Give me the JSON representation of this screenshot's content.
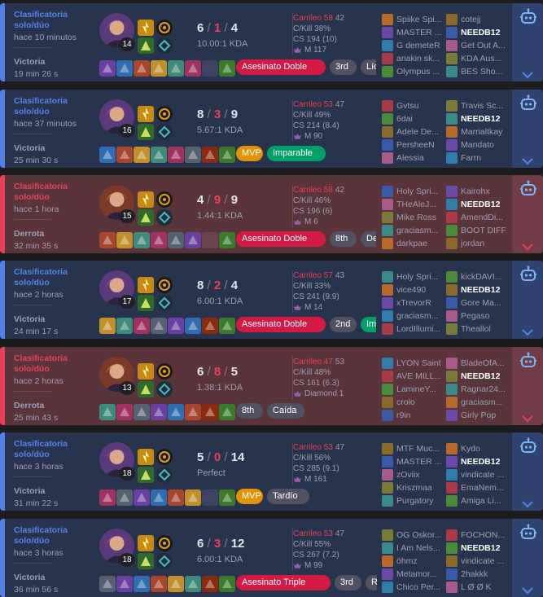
{
  "labels": {
    "kill_participation_prefix": "C/Kill"
  },
  "matches": [
    {
      "result": "win",
      "queue": "Clasificatoria solo/dúo",
      "time_ago": "hace 10 minutos",
      "result_label": "Victoria",
      "duration": "19 min 26 s",
      "level": "14",
      "champion_icon": "purple-haired-champion-icon",
      "kda_k": "6",
      "kda_d": "1",
      "kda_a": "4",
      "kda_ratio": "10.00:1 KDA",
      "lp": "Carrileo 58",
      "lp_avg": "42",
      "kill_part": "C/Kill 38%",
      "cs": "CS 194 (10)",
      "rank": "M 117",
      "badges": [
        {
          "text": "Asesinato Doble",
          "color": "red"
        },
        {
          "text": "3rd",
          "color": "gray"
        },
        {
          "text": "Líder",
          "color": "gray"
        }
      ],
      "team1": [
        "Spiike Spi...",
        "MASTER ...",
        "G demeteR",
        "anakin sk...",
        "Olympus ..."
      ],
      "team2": [
        "cotejj",
        "NEEDB12",
        "Get Out A...",
        "KDA Aus...",
        "BES Sho..."
      ]
    },
    {
      "result": "win",
      "queue": "Clasificatoria solo/dúo",
      "time_ago": "hace 37 minutos",
      "result_label": "Victoria",
      "duration": "25 min 30 s",
      "level": "16",
      "champion_icon": "purple-haired-champion-icon",
      "kda_k": "8",
      "kda_d": "3",
      "kda_a": "9",
      "kda_ratio": "5.67:1 KDA",
      "lp": "Carrileo 53",
      "lp_avg": "47",
      "kill_part": "C/Kill 49%",
      "cs": "CS 214 (8.4)",
      "rank": "M 90",
      "badges": [
        {
          "text": "MVP",
          "color": "gold"
        },
        {
          "text": "Imparable",
          "color": "green"
        }
      ],
      "team1": [
        "Gvtsu",
        "6dai",
        "Adele De...",
        "PersheeN",
        "Alessia"
      ],
      "team2": [
        "Travis Sc...",
        "NEEDB12",
        "Marrialtkay",
        "Mandato",
        "Farrn"
      ]
    },
    {
      "result": "loss",
      "queue": "Clasificatoria solo/dúo",
      "time_ago": "hace 1 hora",
      "result_label": "Derrota",
      "duration": "32 min 35 s",
      "level": "15",
      "champion_icon": "golden-armored-champion-icon",
      "kda_k": "4",
      "kda_d": "9",
      "kda_a": "9",
      "kda_ratio": "1.44:1 KDA",
      "lp": "Carrileo 58",
      "lp_avg": "42",
      "kill_part": "C/Kill 46%",
      "cs": "CS 196 (6)",
      "rank": "M 6",
      "badges": [
        {
          "text": "Asesinato Doble",
          "color": "red"
        },
        {
          "text": "8th",
          "color": "gray"
        },
        {
          "text": "Desafo",
          "color": "gray"
        }
      ],
      "team1": [
        "Holy Spri...",
        "THeAleJ...",
        "Mike Ross",
        "graciasm...",
        "darkpae"
      ],
      "team2": [
        "Kairohx",
        "NEEDB12",
        "AmendDi...",
        "BOOT DIFF",
        "jordan"
      ]
    },
    {
      "result": "win",
      "queue": "Clasificatoria solo/dúo",
      "time_ago": "hace 2 horas",
      "result_label": "Victoria",
      "duration": "24 min 17 s",
      "level": "17",
      "champion_icon": "void-champion-icon",
      "kda_k": "8",
      "kda_d": "2",
      "kda_a": "4",
      "kda_ratio": "6.00:1 KDA",
      "lp": "Carrileo 57",
      "lp_avg": "43",
      "kill_part": "C/Kill 33%",
      "cs": "CS 241 (9.9)",
      "rank": "M 14",
      "badges": [
        {
          "text": "Asesinato Doble",
          "color": "red"
        },
        {
          "text": "2nd",
          "color": "gray"
        },
        {
          "text": "Impara",
          "color": "green"
        }
      ],
      "team1": [
        "Holy Spri...",
        "vice490",
        "xTrevorR",
        "graciasm...",
        "LordIllumi..."
      ],
      "team2": [
        "kickDAVI...",
        "NEEDB12",
        "Gore Ma...",
        "Pegaso",
        "Theallol"
      ]
    },
    {
      "result": "loss",
      "queue": "Clasificatoria solo/dúo",
      "time_ago": "hace 2 horas",
      "result_label": "Derrota",
      "duration": "25 min 43 s",
      "level": "13",
      "champion_icon": "hooded-champion-icon",
      "kda_k": "6",
      "kda_d": "8",
      "kda_a": "5",
      "kda_ratio": "1.38:1 KDA",
      "lp": "Carrileo 47",
      "lp_avg": "53",
      "kill_part": "C/Kill 48%",
      "cs": "CS 161 (6.3)",
      "rank": "Diamond 1",
      "badges": [
        {
          "text": "8th",
          "color": "gray"
        },
        {
          "text": "Caída",
          "color": "gray"
        }
      ],
      "team1": [
        "LYON Saint",
        "AVE MILL...",
        "LamineY...",
        "crolo",
        "r9in"
      ],
      "team2": [
        "BladeOfA...",
        "NEEDB12",
        "Ragnar24...",
        "graciasm...",
        "Girly Pop"
      ]
    },
    {
      "result": "win",
      "queue": "Clasificatoria solo/dúo",
      "time_ago": "hace 3 horas",
      "result_label": "Victoria",
      "duration": "31 min 22 s",
      "level": "18",
      "champion_icon": "purple-haired-champion-icon",
      "kda_k": "5",
      "kda_d": "0",
      "kda_a": "14",
      "kda_ratio": "Perfect",
      "lp": "Carrileo 53",
      "lp_avg": "47",
      "kill_part": "C/Kill 56%",
      "cs": "CS 285 (9.1)",
      "rank": "M 161",
      "badges": [
        {
          "text": "MVP",
          "color": "gold"
        },
        {
          "text": "Tardío",
          "color": "gray"
        }
      ],
      "team1": [
        "MTF Muc...",
        "MASTER ...",
        "zOviix",
        "Kriszmaa",
        "Purgatory"
      ],
      "team2": [
        "Kydo",
        "NEEDB12",
        "vindicate ...",
        "EmaNem...",
        "Amiga Li..."
      ]
    },
    {
      "result": "win",
      "queue": "Clasificatoria solo/dúo",
      "time_ago": "hace 3 horas",
      "result_label": "Victoria",
      "duration": "36 min 56 s",
      "level": "18",
      "champion_icon": "dark-haired-champion-icon",
      "kda_k": "6",
      "kda_d": "3",
      "kda_a": "12",
      "kda_ratio": "6.00:1 KDA",
      "lp": "Carrileo 53",
      "lp_avg": "47",
      "kill_part": "C/Kill 55%",
      "cs": "CS 267 (7.2)",
      "rank": "M 99",
      "badges": [
        {
          "text": "Asesinato Triple",
          "color": "red"
        },
        {
          "text": "3rd",
          "color": "gray"
        },
        {
          "text": "Resilien",
          "color": "gray"
        }
      ],
      "team1": [
        "OG Oskor...",
        "I Am Nels...",
        "öhmz",
        "Metamor...",
        "Chico Per..."
      ],
      "team2": [
        "FOCHON...",
        "NEEDB12",
        "vindicate ...",
        "2hakkk",
        "L Ø Ø K"
      ]
    }
  ]
}
